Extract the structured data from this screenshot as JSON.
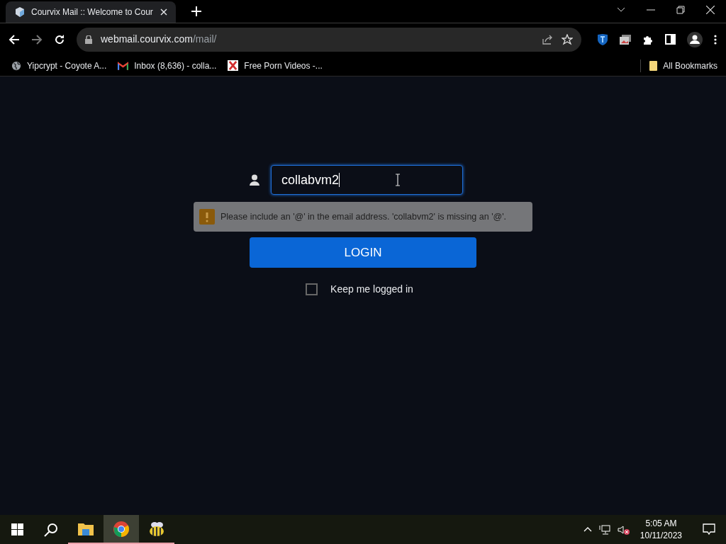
{
  "browser": {
    "tabs": [
      {
        "title": "Courvix Mail :: Welcome to Cour",
        "selected": true
      }
    ],
    "address": {
      "host": "webmail.courvix.com",
      "path": "/mail/"
    },
    "bookmarks": [
      {
        "kind": "globe",
        "label": "Yipcrypt - Coyote A..."
      },
      {
        "kind": "mail",
        "label": "Inbox (8,636) - colla..."
      },
      {
        "kind": "x",
        "label": "Free Porn Videos -..."
      }
    ],
    "all_bookmarks": "All Bookmarks"
  },
  "login": {
    "username": "collabvm2",
    "validation_message": "Please include an '@' in the email address. 'collabvm2' is missing an '@'.",
    "button": "LOGIN",
    "keep_logged_in": {
      "label": "Keep me logged in",
      "checked": false
    }
  },
  "taskbar": {
    "apps": [
      {
        "kind": "folder",
        "selected": false
      },
      {
        "kind": "chrome",
        "selected": true
      },
      {
        "kind": "bee",
        "selected": false
      }
    ],
    "time": "5:05 AM",
    "date": "10/11/2023"
  }
}
